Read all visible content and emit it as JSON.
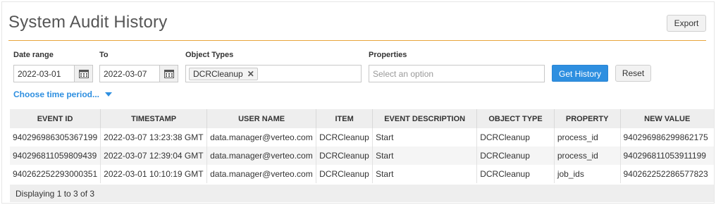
{
  "page": {
    "title": "System Audit History",
    "export_label": "Export"
  },
  "filters": {
    "date_range_label": "Date range",
    "date_from": "2022-03-01",
    "to_label": "To",
    "date_to": "2022-03-07",
    "object_types_label": "Object Types",
    "object_types_selected": [
      "DCRCleanup"
    ],
    "properties_label": "Properties",
    "properties_placeholder": "Select an option",
    "get_history_label": "Get History",
    "reset_label": "Reset",
    "choose_period_label": "Choose time period..."
  },
  "table": {
    "columns": [
      "EVENT ID",
      "TIMESTAMP",
      "USER NAME",
      "ITEM",
      "EVENT DESCRIPTION",
      "OBJECT TYPE",
      "PROPERTY",
      "NEW VALUE"
    ],
    "rows": [
      [
        "940296986305367199",
        "2022-03-07 13:23:38 GMT",
        "data.manager@verteo.com",
        "DCRCleanup",
        "Start",
        "DCRCleanup",
        "process_id",
        "940296986299862175"
      ],
      [
        "940296811059809439",
        "2022-03-07 12:39:04 GMT",
        "data.manager@verteo.com",
        "DCRCleanup",
        "Start",
        "DCRCleanup",
        "process_id",
        "940296811053911199"
      ],
      [
        "940262252293000351",
        "2022-03-01 10:10:19 GMT",
        "data.manager@verteo.com",
        "DCRCleanup",
        "Start",
        "DCRCleanup",
        "job_ids",
        "940262252286577823"
      ]
    ],
    "footer": "Displaying 1 to 3 of 3"
  },
  "colors": {
    "accent": "#2e8fe0",
    "header_rule": "#e8a53c"
  },
  "icons": [
    "calendar-icon",
    "remove-tag-icon",
    "caret-down-icon"
  ]
}
